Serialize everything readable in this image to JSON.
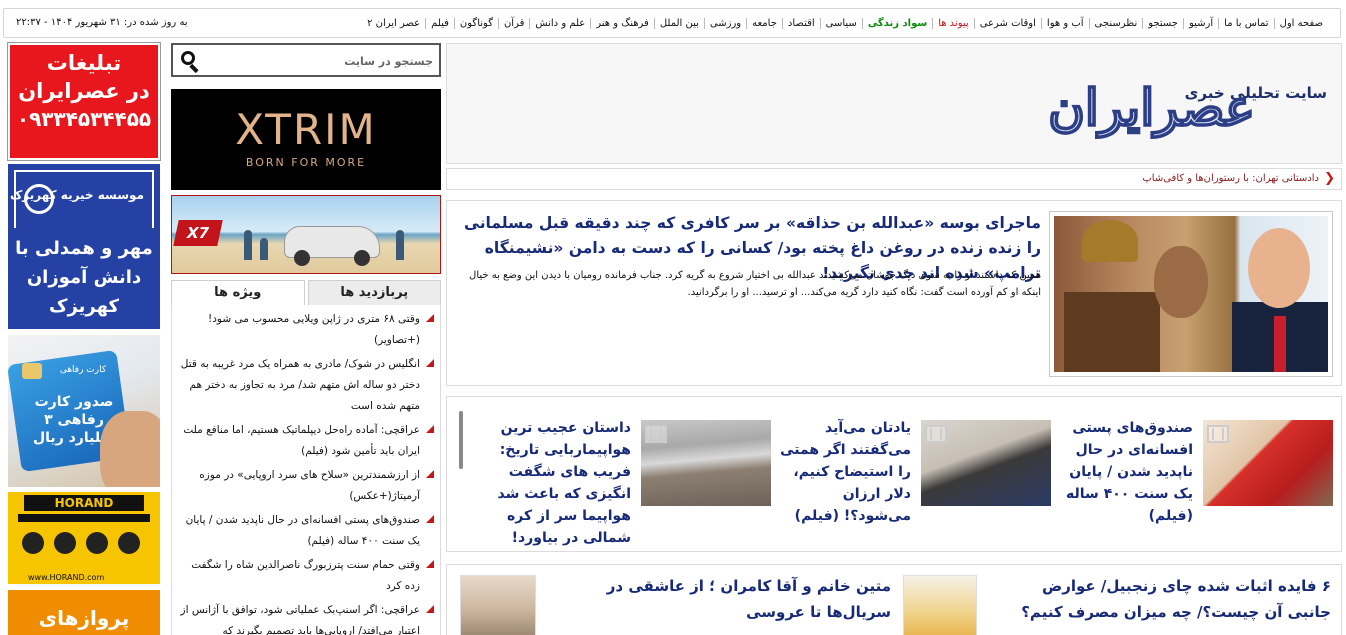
{
  "nav": {
    "items": [
      {
        "label": "صفحه اول",
        "style": "normal"
      },
      {
        "label": "تماس با ما",
        "style": "normal"
      },
      {
        "label": "آرشیو",
        "style": "normal"
      },
      {
        "label": "جستجو",
        "style": "normal"
      },
      {
        "label": "نظرسنجی",
        "style": "normal"
      },
      {
        "label": "آب و هوا",
        "style": "normal"
      },
      {
        "label": "اوقات شرعی",
        "style": "normal"
      },
      {
        "label": "پیوند ها",
        "style": "red"
      },
      {
        "label": "سواد زندگی",
        "style": "green"
      },
      {
        "label": "سیاسی",
        "style": "normal"
      },
      {
        "label": "اقتصاد",
        "style": "normal"
      },
      {
        "label": "جامعه",
        "style": "normal"
      },
      {
        "label": "ورزشی",
        "style": "normal"
      },
      {
        "label": "بین الملل",
        "style": "normal"
      },
      {
        "label": "فرهنگ و هنر",
        "style": "normal"
      },
      {
        "label": "علم و دانش",
        "style": "normal"
      },
      {
        "label": "قرآن",
        "style": "normal"
      },
      {
        "label": "گوناگون",
        "style": "normal"
      },
      {
        "label": "فیلم",
        "style": "normal"
      },
      {
        "label": "عصر ایران ۲",
        "style": "normal"
      }
    ],
    "updated": "به روز شده در: ۳۱ شهریور ۱۴۰۴ - ۲۲:۳۷"
  },
  "header": {
    "tagline": "سایت تحلیلی خبری",
    "logo_text": "عصرایران"
  },
  "ticker": {
    "text": "دادستانی تهران: با رستوران‌ها و کافی‌شاپ"
  },
  "lead": {
    "title": "ماجرای بوسه «عبدالله بن حذاقه» بر سر کافری که چند دقیقه قبل مسلمانی را زنده زنده در روغن داغ پخته بود/ کسانی را که دست به دامن «نشیمنگاه ترامپ» شده اند جدی نگیرید!",
    "summary": "همین که داشتند او را به سوی دیگ جوشان می‌کشیدند عبدالله بی اختیار شروع به گریه کرد. جناب فرمانده رومیان با دیدن این وضع به خیال اینکه او کم آورده است گفت: نگاه کنید دارد گریه می‌کند... او ترسید... او را برگردانید."
  },
  "featured": [
    {
      "title": "صندوق‌های پستی افسانه‌ای در حال ناپدید شدن / پایان یک سنت ۴۰۰ ساله (فیلم)",
      "video": true
    },
    {
      "title": "یادتان می‌آید می‌گفتند اگر همتی را استیضاح کنیم، دلار ارزان می‌شود؟! (فیلم)",
      "video": true
    },
    {
      "title": "داستان عجیب ترین هواپیماربایی تاریخ: فریب های شگفت انگیزی که باعث شد هواپیما سر از کره شمالی در بیاورد!",
      "video": true
    }
  ],
  "row3": [
    {
      "title": "۶ فایده اثبات شده چای زنجبیل/ عوارض جانبی آن چیست؟/ چه میزان مصرف کنیم؟"
    },
    {
      "title": "متین خانم و آقا کامران ؛ از عاشقی در سریال‌ها تا عروسی"
    }
  ],
  "search": {
    "placeholder": "جستجو در سایت"
  },
  "ads": {
    "xtrim_brand": "XTRIM",
    "xtrim_slogan": "BORN FOR MORE",
    "car_logo": "X7",
    "left1": {
      "line1": "تبلیغات",
      "line2": "در عصرایران",
      "phone": "۰۹۳۳۴۵۳۴۴۵۵"
    },
    "left2": {
      "org": "موسسه خیریه کهریزک",
      "slogan": "مهر و همدلی با دانش آموزان کهریزک"
    },
    "left3": {
      "small": "کارت رفاهی",
      "big": "صدور کارت رفاهی ۳ میلیارد ریال"
    },
    "left4": {
      "name": "HORAND",
      "url": "www.HORAND.com"
    },
    "left5": {
      "text": "پروازهای"
    }
  },
  "tabs": [
    {
      "label": "ویژه ها",
      "active": true
    },
    {
      "label": "پربازدید ها",
      "active": false
    }
  ],
  "news": [
    "وقتی ۶۸ متری در ژاپن ویلایی محسوب می شود! (+تصاویر)",
    "انگلیس در شوک/ مادری به همراه یک مرد غریبه به قتل دختر دو ساله اش متهم شد/ مرد به تجاوز به دختر هم متهم شده است",
    "عراقچی: آماده راه‌حل دیپلماتیک هستیم، اما منافع ملت ایران باید تأمین شود (فیلم)",
    "از ارزشمندترین «سلاح های سرد اروپایی» در موزه آرمیتاژ(+عکس)",
    "صندوق‌های پستی افسانه‌ای در حال ناپدید شدن / پایان یک سنت ۴۰۰ ساله (فیلم)",
    "وقتی حمام سنت پترزبورگ ناصرالدین شاه را شگفت زده کرد",
    "عراقچی: اگر اسنپ‌بک عملیاتی شود، توافق با آژانس از اعتبار می‌افتد/ اروپایی‌ها باید تصمیم بگیرند که"
  ],
  "colors": {
    "headline": "#172a78",
    "accent_red": "#c81818",
    "accent_green": "#0a8a0a"
  }
}
